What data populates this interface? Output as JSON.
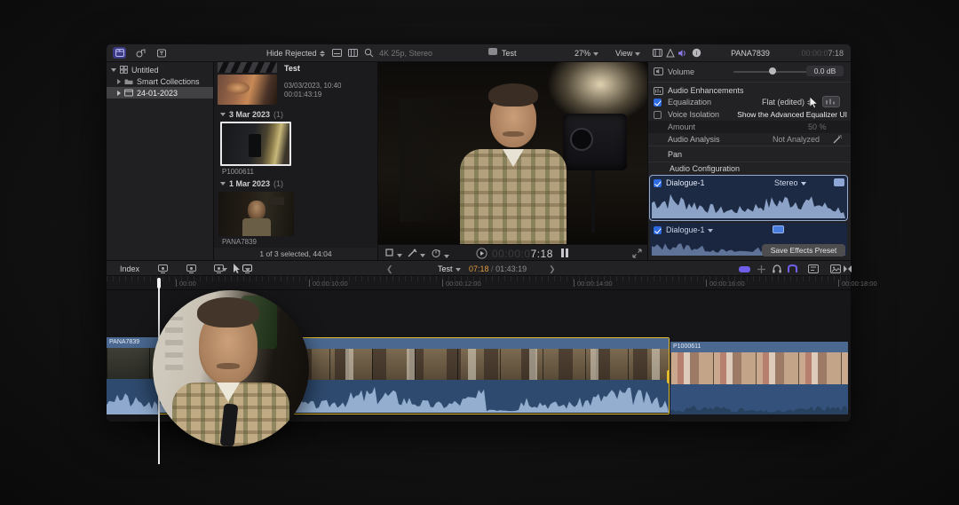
{
  "accents": {
    "selection_yellow": "#e2bc2e",
    "timecode_orange": "#e09a3e",
    "active_purple": "#7b68ee",
    "checkbox_blue": "#2e6ae0",
    "track_blue": "#1c2a44",
    "waveform_blue": "#93aecf"
  },
  "icons": {
    "library_sidebar": "clapperboard-blue",
    "search": "magnifier",
    "audio_tab": "speaker-purple",
    "info_tab": "circle-i",
    "solo": "headphones",
    "select_tool": "arrow-pointer"
  },
  "toolbar": {
    "hide_rejected": "Hide Rejected",
    "format_info": "4K 25p, Stereo",
    "viewer_project": "Test",
    "zoom": "27%",
    "view": "View"
  },
  "sidebar": {
    "library": "Untitled",
    "smart_collections": "Smart Collections",
    "event": "24-01-2023"
  },
  "browser": {
    "project_name": "Test",
    "project_date": "03/03/2023, 10:40",
    "project_duration": "00:01:43:19",
    "group1_label": "3 Mar 2023",
    "group1_count": "(1)",
    "clip1_name": "P1000611",
    "group2_label": "1 Mar 2023",
    "group2_count": "(1)",
    "clip2_name": "PANA7839",
    "status": "1 of 3 selected, 44:04"
  },
  "viewer": {
    "tc_dim": "00:00:0",
    "tc_bright": "7:18"
  },
  "inspector": {
    "clip_name": "PANA7839",
    "tc_dim": "00:00:0",
    "tc_bright": "7:18",
    "volume_label": "Volume",
    "volume_value": "0.0 dB",
    "enhancements_header": "Audio Enhancements",
    "equalization_label": "Equalization",
    "equalization_value": "Flat (edited)",
    "tooltip": "Show the Advanced Equalizer UI",
    "voice_isolation_label": "Voice Isolation",
    "amount_label": "Amount",
    "amount_value": "50 %",
    "analysis_label": "Audio Analysis",
    "analysis_value": "Not Analyzed",
    "pan_header": "Pan",
    "config_header": "Audio Configuration",
    "track1_name": "Dialogue-1",
    "track1_channels": "Stereo",
    "track2_name": "Dialogue-1",
    "save_button": "Save Effects Preset"
  },
  "timeline": {
    "index_button": "Index",
    "project": "Test",
    "tc_current": "07:18",
    "tc_sep": "/",
    "tc_total": "01:43:19",
    "ruler_labels": [
      "00:00",
      "00:00:10:00",
      "00:00:12:00",
      "00:00:14:00",
      "00:00:16:00",
      "00:00:18:00"
    ],
    "clip1_name": "PANA7839",
    "clip3_name": "P1000611"
  }
}
